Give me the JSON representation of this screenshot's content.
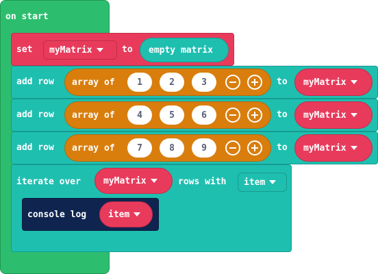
{
  "on_start": {
    "label": "on start"
  },
  "set_block": {
    "keyword": "set",
    "variable": "myMatrix",
    "to_word": "to",
    "value": "empty matrix"
  },
  "add_rows": [
    {
      "keyword": "add row",
      "array_label": "array of",
      "values": [
        "1",
        "2",
        "3"
      ],
      "to_word": "to",
      "target": "myMatrix"
    },
    {
      "keyword": "add row",
      "array_label": "array of",
      "values": [
        "4",
        "5",
        "6"
      ],
      "to_word": "to",
      "target": "myMatrix"
    },
    {
      "keyword": "add row",
      "array_label": "array of",
      "values": [
        "7",
        "8",
        "9"
      ],
      "to_word": "to",
      "target": "myMatrix"
    }
  ],
  "iterate": {
    "keyword": "iterate over",
    "variable": "myMatrix",
    "rows_word": "rows with",
    "item_var": "item"
  },
  "console_log": {
    "keyword": "console log",
    "argument": "item"
  },
  "colors": {
    "event": "#2dbd6e",
    "variables": "#e83b5c",
    "arrays": "#1fbfb0",
    "array_literal": "#d97e0d",
    "console": "#0f2550"
  }
}
